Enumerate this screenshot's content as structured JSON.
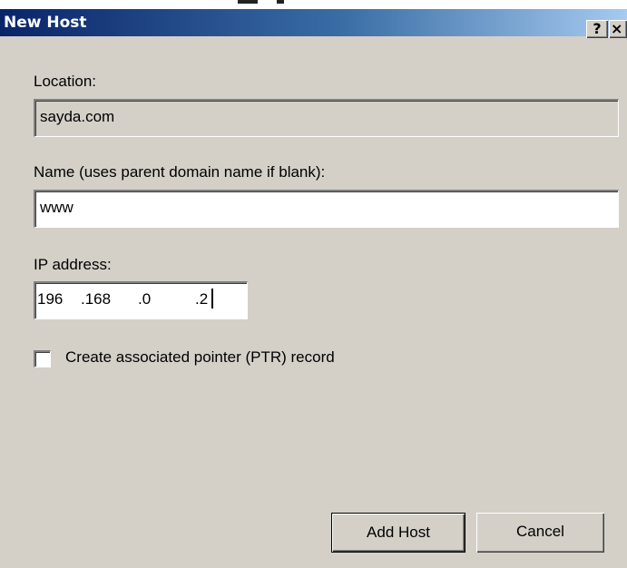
{
  "dialog": {
    "title": "New Host",
    "help_glyph": "?",
    "close_glyph": "×"
  },
  "location": {
    "label": "Location:",
    "value": "sayda.com"
  },
  "name_field": {
    "label": "Name (uses parent domain name if blank):",
    "value": "www"
  },
  "ip_address": {
    "label": "IP address:",
    "octets": [
      "196",
      ".168",
      ".0",
      ".2"
    ]
  },
  "ptr_checkbox": {
    "label": "Create associated pointer (PTR) record",
    "checked": false
  },
  "buttons": {
    "add_host": "Add Host",
    "cancel": "Cancel"
  },
  "colors": {
    "title_start": "#0a246a",
    "title_end": "#a6caf0",
    "face": "#d4d0c8"
  }
}
